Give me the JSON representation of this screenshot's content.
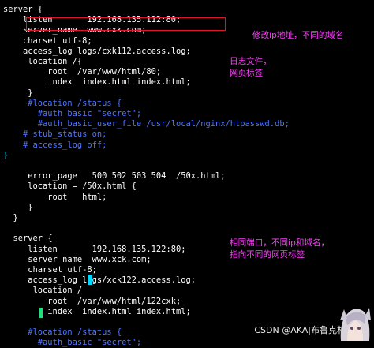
{
  "lines": [
    {
      "text": "server {",
      "color": "white"
    },
    {
      "text": "    listen       192.168.135.112:80;",
      "color": "white"
    },
    {
      "text": "    server_name  www.cxk.com;",
      "color": "white"
    },
    {
      "text": "    charset utf-8;",
      "color": "white"
    },
    {
      "text": "    access_log logs/cxk112.access.log;",
      "color": "white"
    },
    {
      "text": "     location /{",
      "color": "white"
    },
    {
      "text": "         root  /var/www/html/80;",
      "color": "white"
    },
    {
      "text": "         index  index.html index.html;",
      "color": "white"
    },
    {
      "text": "     }",
      "color": "white"
    },
    {
      "text": "     #location /status {",
      "color": "comment"
    },
    {
      "text": "       #auth_basic \"secret\";",
      "color": "comment"
    },
    {
      "text": "       #auth_basic_user_file /usr/local/nginx/htpasswd.db;",
      "color": "comment"
    },
    {
      "text": "    # stub_status on;",
      "color": "comment"
    },
    {
      "text": "    # access_log off;",
      "color": "comment"
    },
    {
      "text": "}",
      "color": "cyan"
    },
    {
      "text": "",
      "color": "white"
    },
    {
      "text": "     error_page   500 502 503 504  /50x.html;",
      "color": "white"
    },
    {
      "text": "     location = /50x.html {",
      "color": "white"
    },
    {
      "text": "         root   html;",
      "color": "white"
    },
    {
      "text": "     }",
      "color": "white"
    },
    {
      "text": "  }",
      "color": "white"
    },
    {
      "text": "",
      "color": "white"
    },
    {
      "text": "  server {",
      "color": "white"
    },
    {
      "text": "     listen       192.168.135.122:80;",
      "color": "white"
    },
    {
      "text": "     server_name  www.xck.com;",
      "color": "white"
    },
    {
      "text": "     charset utf-8;",
      "color": "white"
    },
    {
      "text": "     access_log logs/xck122.access.log;",
      "color": "white"
    },
    {
      "text": "      location /",
      "color": "white"
    },
    {
      "text": "         root  /var/www/html/122cxk;",
      "color": "white"
    },
    {
      "text": "         index  index.html index.html;",
      "color": "white"
    },
    {
      "text": "",
      "color": "white"
    },
    {
      "text": "     #location /status {",
      "color": "comment"
    },
    {
      "text": "       #auth_basic \"secret\";",
      "color": "comment"
    }
  ],
  "annotations": {
    "modify_ip": "修改ip地址，不同的域名",
    "log_file": "日志文件，\n网页标签",
    "same_port": "相同端口，不同ip和域名，\n指向不同的网页标签"
  },
  "watermark": "CSDN @AKA|布鲁克林|Tom",
  "colors": {
    "background": "#000000",
    "text": "#ffffff",
    "comment": "#4f76ff",
    "cyan_brace": "#2ad4f0",
    "annotation": "#ff3cff",
    "highlight_box": "#e0142c",
    "cursor": "#00d8ff"
  }
}
